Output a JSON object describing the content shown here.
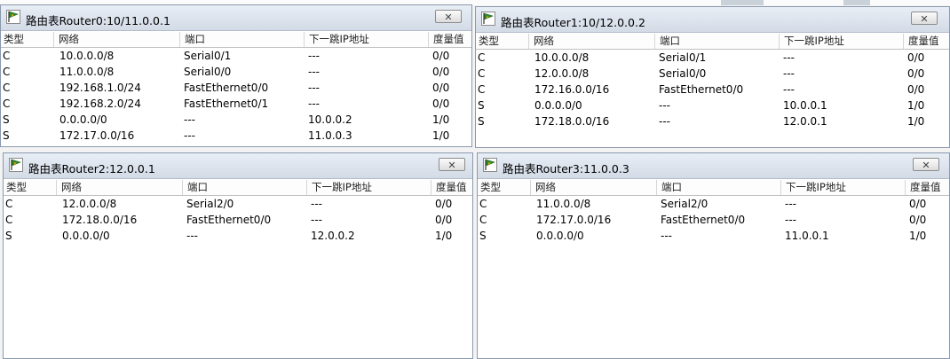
{
  "columns": [
    "类型",
    "网络",
    "端口",
    "下一跳IP地址",
    "度量值"
  ],
  "close_label": "✕",
  "colors": {
    "titlebar": "#d9e1ec",
    "border": "#8a99ad",
    "background": "#f3f3f3"
  },
  "windows": [
    {
      "title": "路由表Router0:10/11.0.0.1",
      "rows": [
        [
          "C",
          "10.0.0.0/8",
          "Serial0/1",
          "---",
          "0/0"
        ],
        [
          "C",
          "11.0.0.0/8",
          "Serial0/0",
          "---",
          "0/0"
        ],
        [
          "C",
          "192.168.1.0/24",
          "FastEthernet0/0",
          "---",
          "0/0"
        ],
        [
          "C",
          "192.168.2.0/24",
          "FastEthernet0/1",
          "---",
          "0/0"
        ],
        [
          "S",
          "0.0.0.0/0",
          "---",
          "10.0.0.2",
          "1/0"
        ],
        [
          "S",
          "172.17.0.0/16",
          "---",
          "11.0.0.3",
          "1/0"
        ]
      ]
    },
    {
      "title": "路由表Router1:10/12.0.0.2",
      "rows": [
        [
          "C",
          "10.0.0.0/8",
          "Serial0/1",
          "---",
          "0/0"
        ],
        [
          "C",
          "12.0.0.0/8",
          "Serial0/0",
          "---",
          "0/0"
        ],
        [
          "C",
          "172.16.0.0/16",
          "FastEthernet0/0",
          "---",
          "0/0"
        ],
        [
          "S",
          "0.0.0.0/0",
          "---",
          "10.0.0.1",
          "1/0"
        ],
        [
          "S",
          "172.18.0.0/16",
          "---",
          "12.0.0.1",
          "1/0"
        ]
      ]
    },
    {
      "title": "路由表Router2:12.0.0.1",
      "rows": [
        [
          "C",
          "12.0.0.0/8",
          "Serial2/0",
          "---",
          "0/0"
        ],
        [
          "C",
          "172.18.0.0/16",
          "FastEthernet0/0",
          "---",
          "0/0"
        ],
        [
          "S",
          "0.0.0.0/0",
          "---",
          "12.0.0.2",
          "1/0"
        ]
      ]
    },
    {
      "title": "路由表Router3:11.0.0.3",
      "rows": [
        [
          "C",
          "11.0.0.0/8",
          "Serial2/0",
          "---",
          "0/0"
        ],
        [
          "C",
          "172.17.0.0/16",
          "FastEthernet0/0",
          "---",
          "0/0"
        ],
        [
          "S",
          "0.0.0.0/0",
          "---",
          "11.0.0.1",
          "1/0"
        ]
      ]
    }
  ]
}
